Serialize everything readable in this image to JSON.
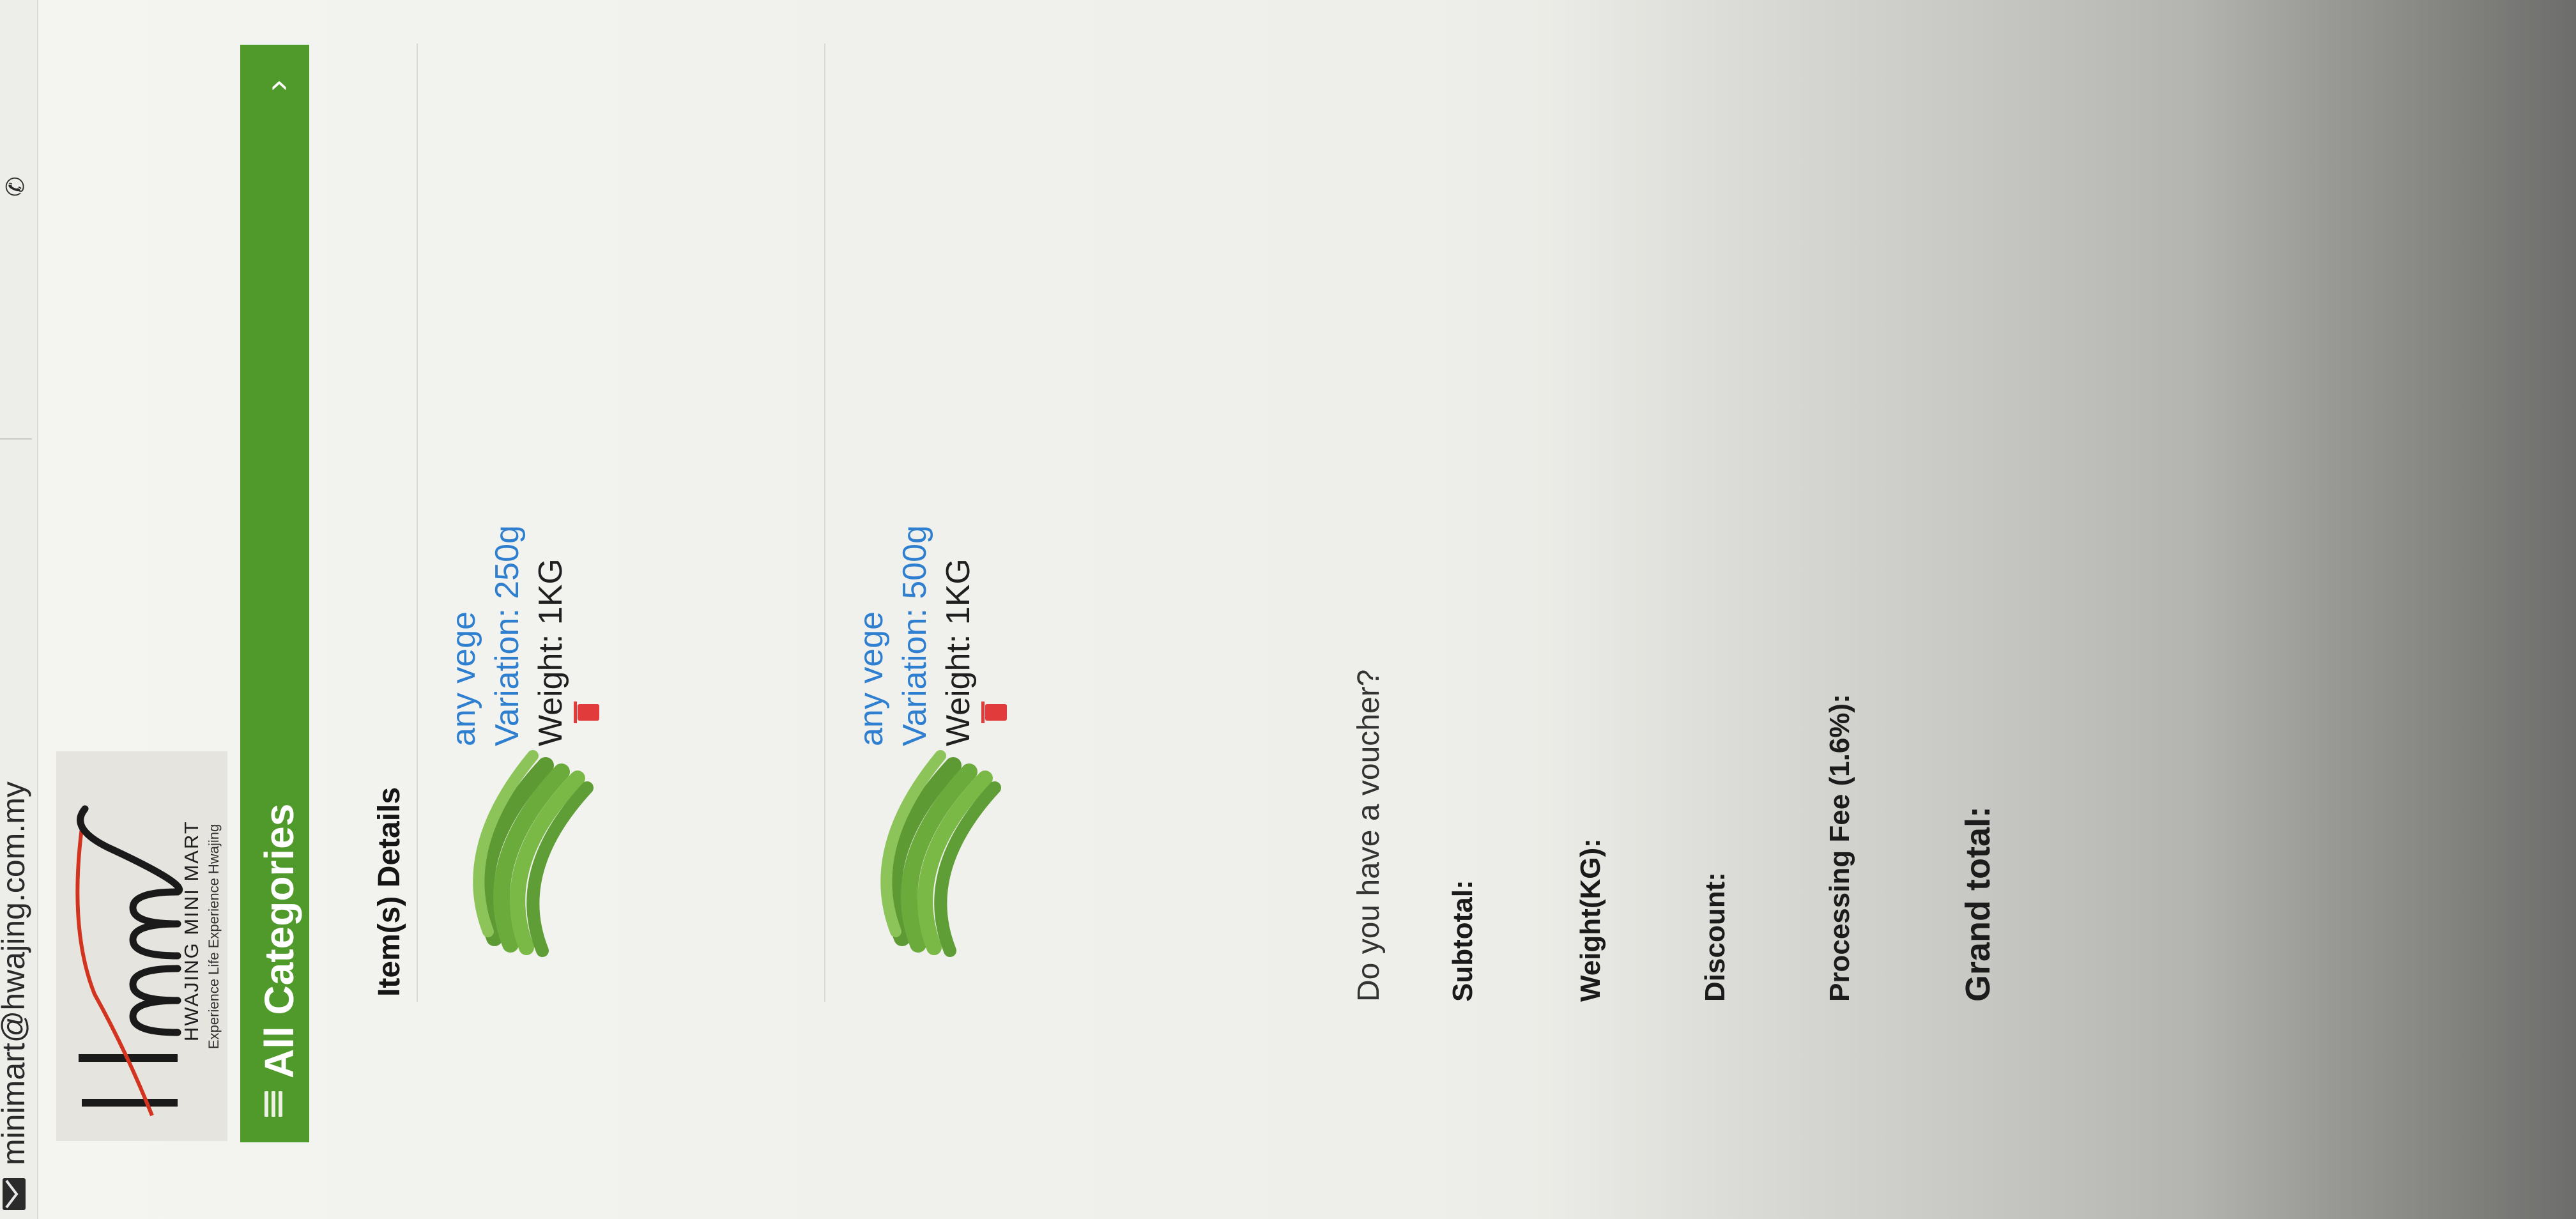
{
  "contact": {
    "email": "minimart@hwajing.com.my",
    "email_icon": "mail-icon",
    "phone_icon": "phone-icon"
  },
  "brand": {
    "logo_text": "Hmm",
    "name": "HWAJING MINI MART",
    "tagline": "Experience Life Experience Hwajing"
  },
  "nav": {
    "categories_label": "All Categories",
    "menu_icon": "hamburger-menu-icon",
    "toggle_icon": "chevron-down-icon",
    "accent_color": "#4f9a2a"
  },
  "cart": {
    "section_title": "Item(s) Details",
    "items": [
      {
        "name": "any vege",
        "variation": "Variation: 250g",
        "weight": "Weight: 1KG",
        "image_icon": "green-beans-image",
        "remove_icon": "trash-icon"
      },
      {
        "name": "any vege",
        "variation": "Variation: 500g",
        "weight": "Weight: 1KG",
        "image_icon": "green-beans-image",
        "remove_icon": "trash-icon"
      }
    ],
    "voucher_prompt": "Do you have a voucher?",
    "link_color": "#2f7fd0",
    "remove_color": "#e23b3b"
  },
  "totals": {
    "subtotal_label": "Subtotal:",
    "weight_label": "Weight(KG):",
    "discount_label": "Discount:",
    "fee_label": "Processing Fee (1.6%):",
    "grand_total_label": "Grand total:"
  }
}
